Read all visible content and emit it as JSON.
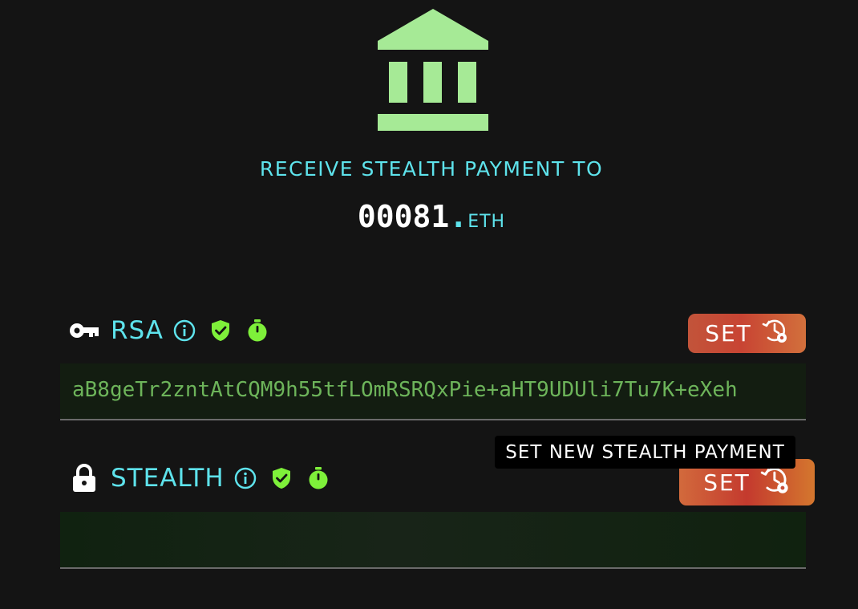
{
  "header": {
    "icon": "bank-icon",
    "label": "RECEIVE STEALTH PAYMENT TO",
    "name": "00081",
    "dot": ".",
    "tld": "ETH"
  },
  "rows": [
    {
      "lead_icon": "key-icon",
      "label": "RSA",
      "status_icons": [
        "info-icon",
        "shield-check-icon",
        "stopwatch-icon"
      ],
      "button_label": "SET",
      "button_icon": "history-gear-icon",
      "value": "aB8geTr2zntAtCQM9h55tfLOmRSRQxPie+aHT9UDUli7Tu7K+eXeh"
    },
    {
      "lead_icon": "lock-icon",
      "label": "STEALTH",
      "status_icons": [
        "info-icon",
        "shield-check-icon",
        "stopwatch-icon"
      ],
      "button_label": "SET",
      "button_icon": "history-gear-icon",
      "value": ""
    }
  ],
  "tooltip": "SET NEW STEALTH PAYMENT",
  "colors": {
    "background": "#141414",
    "accent": "#5ee3ec",
    "icon_green": "#a6ea96",
    "status_green": "#7ef03a",
    "field_text": "#6db45a"
  }
}
